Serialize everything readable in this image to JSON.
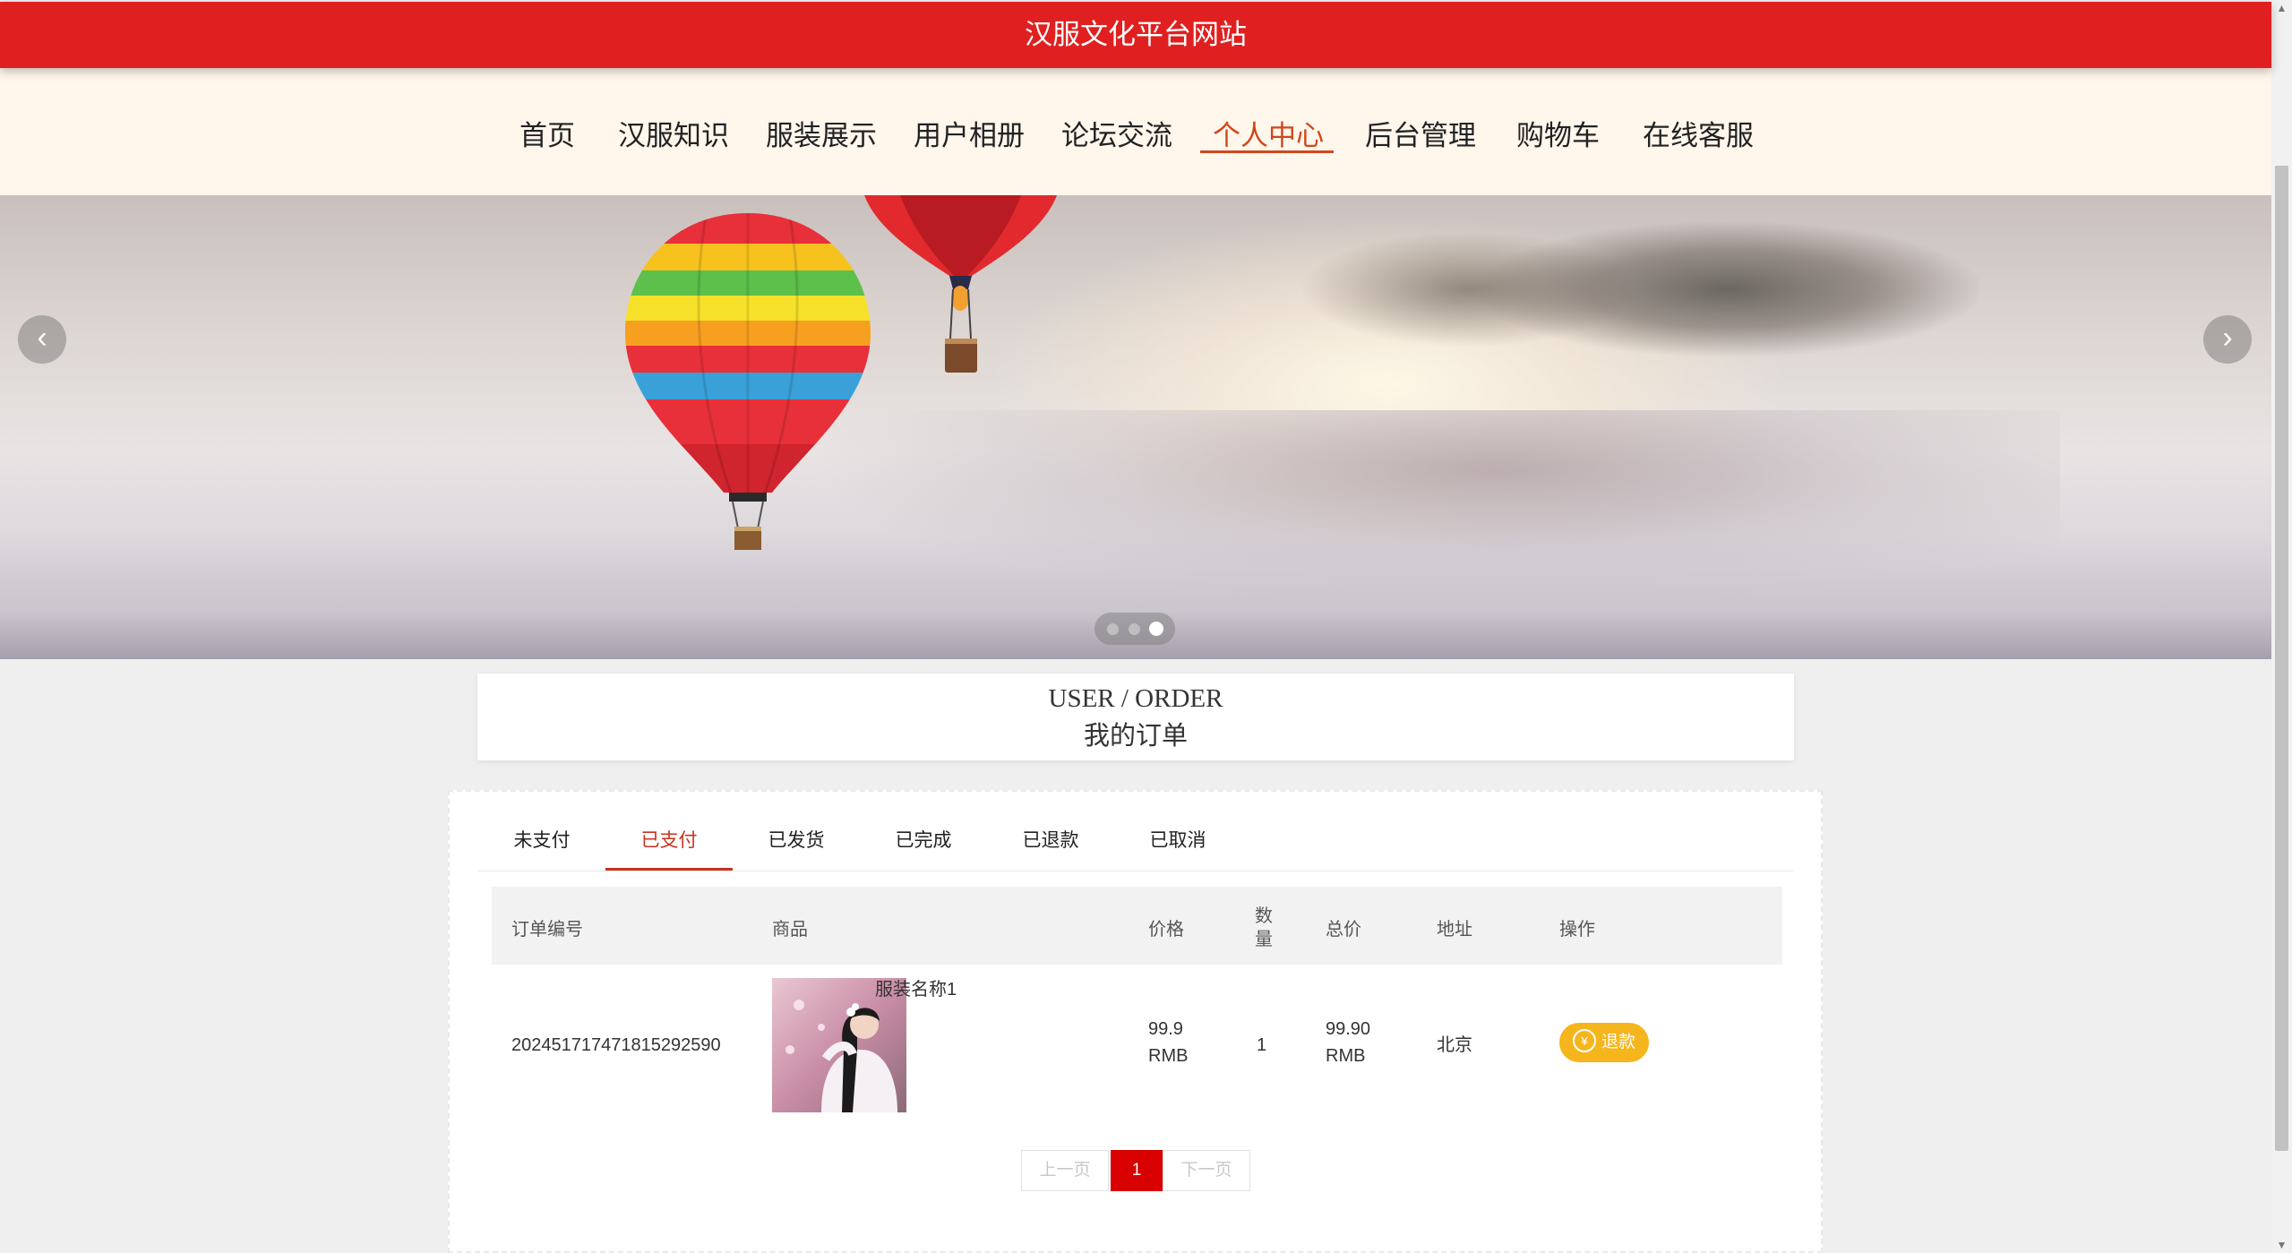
{
  "site": {
    "title": "汉服文化平台网站"
  },
  "nav": {
    "items": [
      {
        "label": "首页"
      },
      {
        "label": "汉服知识"
      },
      {
        "label": "服装展示"
      },
      {
        "label": "用户相册"
      },
      {
        "label": "论坛交流"
      },
      {
        "label": "个人中心",
        "active": true
      },
      {
        "label": "后台管理"
      },
      {
        "label": "购物车"
      },
      {
        "label": "在线客服"
      }
    ]
  },
  "banner": {
    "prev_icon": "chevron-left-icon",
    "next_icon": "chevron-right-icon",
    "slide_count": 3,
    "active_slide": 3
  },
  "section": {
    "title_en": "USER / ORDER",
    "title_cn": "我的订单"
  },
  "tabs": [
    {
      "label": "未支付"
    },
    {
      "label": "已支付",
      "active": true
    },
    {
      "label": "已发货"
    },
    {
      "label": "已完成"
    },
    {
      "label": "已退款"
    },
    {
      "label": "已取消"
    }
  ],
  "table": {
    "headers": {
      "order_no": "订单编号",
      "product": "商品",
      "price": "价格",
      "qty_1": "数",
      "qty_2": "量",
      "total": "总价",
      "address": "地址",
      "action": "操作"
    },
    "rows": [
      {
        "order_no": "2024517174718152925​90",
        "product_name": "服装名称1",
        "price": "99.9",
        "price_unit": "RMB",
        "qty": "1",
        "total": "99.90",
        "total_unit": "RMB",
        "address": "北京",
        "action_label": "退款",
        "action_icon": "yen-icon"
      }
    ]
  },
  "pagination": {
    "prev": "上一页",
    "current": "1",
    "next": "下一页"
  },
  "colors": {
    "brand_red": "#e02020",
    "accent": "#d2461a",
    "refund": "#f5b51c",
    "page_active": "#d80000"
  }
}
